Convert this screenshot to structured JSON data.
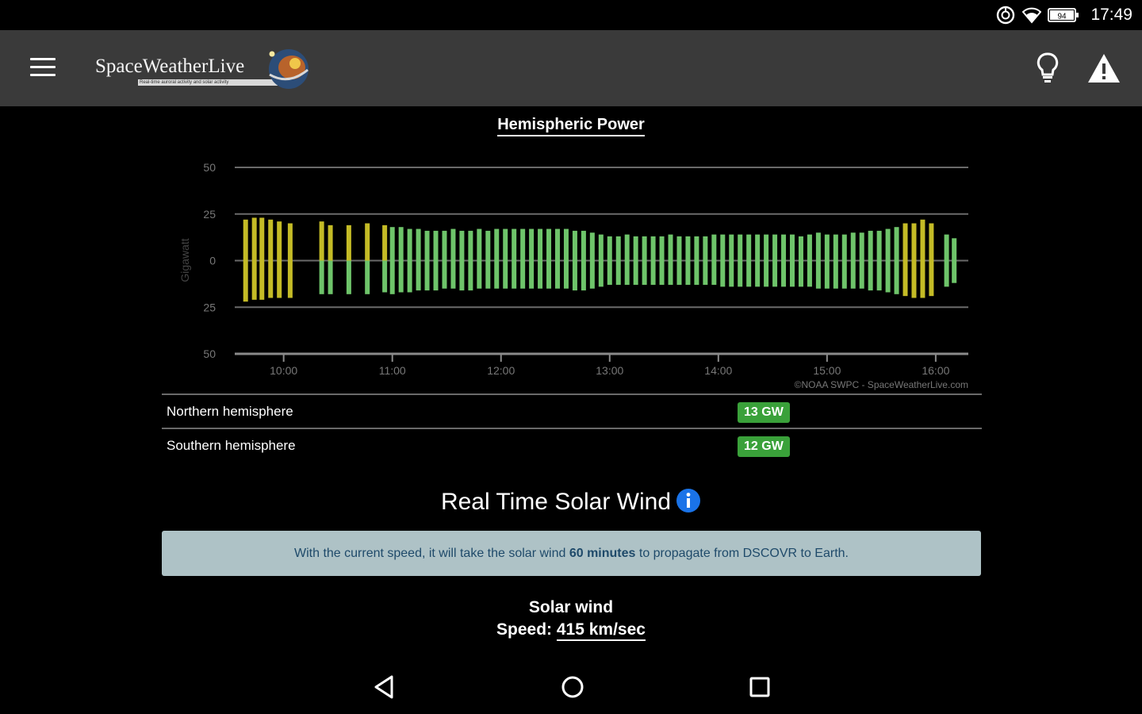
{
  "status_bar": {
    "time": "17:49",
    "battery_level": "94",
    "icons": [
      "sync-icon",
      "wifi-icon",
      "battery-icon"
    ]
  },
  "app_bar": {
    "logo_text": "SpaceWeatherLive",
    "logo_tagline": "Real-time auroral activity and solar activity",
    "icons": [
      "menu-icon",
      "lightbulb-icon",
      "alert-icon"
    ]
  },
  "hemispheric_power": {
    "title": "Hemispheric Power",
    "chart_data": {
      "type": "bar",
      "title": "Hemispheric Power",
      "ylabel": "Gigawatt",
      "xlabel": "",
      "ytick_labels": [
        "50",
        "25",
        "0",
        "25",
        "50"
      ],
      "xtick_labels": [
        "10:00",
        "11:00",
        "12:00",
        "13:00",
        "14:00",
        "15:00",
        "16:00"
      ],
      "x_range_hours": [
        9.55,
        16.3
      ],
      "ylim": [
        -50,
        50
      ],
      "grid": true,
      "credit": "©NOAA SWPC - SpaceWeatherLive.com",
      "colors": {
        "yellow": "#c4bb26",
        "green": "#6ec46a"
      },
      "note": "",
      "series": [
        {
          "x": [
            9.65,
            9.73,
            9.8,
            9.88,
            9.96,
            10.06,
            10.35,
            10.43,
            10.6,
            10.77,
            10.93,
            11.0,
            11.08,
            11.16,
            11.24,
            11.32,
            11.4,
            11.48,
            11.56,
            11.64,
            11.72,
            11.8,
            11.88,
            11.96,
            12.04,
            12.12,
            12.2,
            12.28,
            12.36,
            12.44,
            12.52,
            12.6,
            12.68,
            12.76,
            12.84,
            12.92,
            13.0,
            13.08,
            13.16,
            13.24,
            13.32,
            13.4,
            13.48,
            13.56,
            13.64,
            13.72,
            13.8,
            13.88,
            13.96,
            14.04,
            14.12,
            14.2,
            14.28,
            14.36,
            14.44,
            14.52,
            14.6,
            14.68,
            14.76,
            14.84,
            14.92,
            15.0,
            15.08,
            15.16,
            15.24,
            15.32,
            15.4,
            15.48,
            15.56,
            15.64,
            15.72,
            15.8,
            15.88,
            15.96,
            16.1,
            16.17
          ],
          "north": [
            22,
            23,
            23,
            22,
            21,
            20,
            21,
            19,
            19,
            20,
            19,
            18,
            18,
            17,
            17,
            16,
            16,
            16,
            17,
            16,
            16,
            17,
            16,
            17,
            17,
            17,
            17,
            17,
            17,
            17,
            17,
            17,
            16,
            16,
            15,
            14,
            13,
            13,
            14,
            13,
            13,
            13,
            13,
            14,
            13,
            13,
            13,
            13,
            14,
            14,
            14,
            14,
            14,
            14,
            14,
            14,
            14,
            14,
            13,
            14,
            15,
            14,
            14,
            14,
            15,
            15,
            16,
            16,
            17,
            18,
            20,
            20,
            22,
            20,
            14,
            12
          ],
          "south": [
            -22,
            -21,
            -21,
            -20,
            -20,
            -20,
            -18,
            -18,
            -18,
            -18,
            -17,
            -18,
            -17,
            -17,
            -16,
            -16,
            -16,
            -15,
            -15,
            -16,
            -16,
            -15,
            -15,
            -15,
            -15,
            -15,
            -15,
            -15,
            -15,
            -15,
            -15,
            -15,
            -16,
            -16,
            -15,
            -14,
            -13,
            -13,
            -13,
            -13,
            -13,
            -13,
            -13,
            -13,
            -13,
            -13,
            -13,
            -13,
            -13,
            -14,
            -14,
            -14,
            -14,
            -14,
            -14,
            -14,
            -14,
            -14,
            -14,
            -14,
            -15,
            -15,
            -15,
            -15,
            -15,
            -15,
            -16,
            -16,
            -17,
            -18,
            -19,
            -20,
            -20,
            -19,
            -14,
            -12
          ]
        }
      ]
    },
    "rows": [
      {
        "label": "Northern hemisphere",
        "value": "13 GW"
      },
      {
        "label": "Southern hemisphere",
        "value": "12 GW"
      }
    ]
  },
  "solar_wind": {
    "title": "Real Time Solar Wind",
    "note_prefix": "With the current speed, it will take the solar wind ",
    "note_bold": "60 minutes",
    "note_suffix": " to propagate from DSCOVR to Earth.",
    "label": "Solar wind",
    "speed_label": "Speed: ",
    "speed_value": "415 km/sec"
  },
  "nav_bar": {
    "icons": [
      "back-icon",
      "home-icon",
      "recents-icon"
    ]
  }
}
